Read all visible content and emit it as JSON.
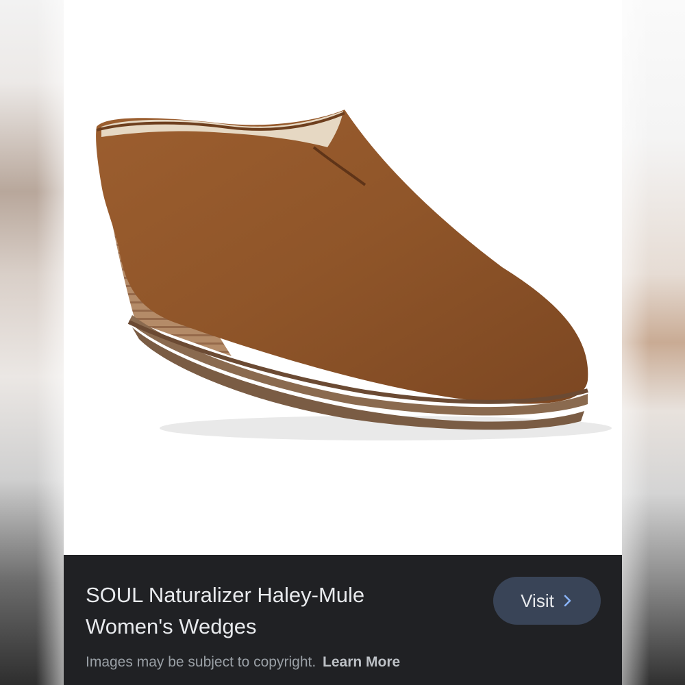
{
  "result": {
    "title_line1": "SOUL Naturalizer Haley-Mule",
    "title_line2": "Women's Wedges",
    "image_subject": "brown suede wedge mule shoe"
  },
  "actions": {
    "visit_label": "Visit"
  },
  "footer": {
    "copyright_text": "Images may be subject to copyright.",
    "learn_more_label": "Learn More"
  },
  "icons": {
    "visit": "chevron-right-icon"
  },
  "colors": {
    "panel_bg": "#202124",
    "button_bg": "#394457",
    "title_text": "#e8eaed",
    "muted_text": "#9aa0a6",
    "shoe_suede": "#9a5c2e"
  }
}
